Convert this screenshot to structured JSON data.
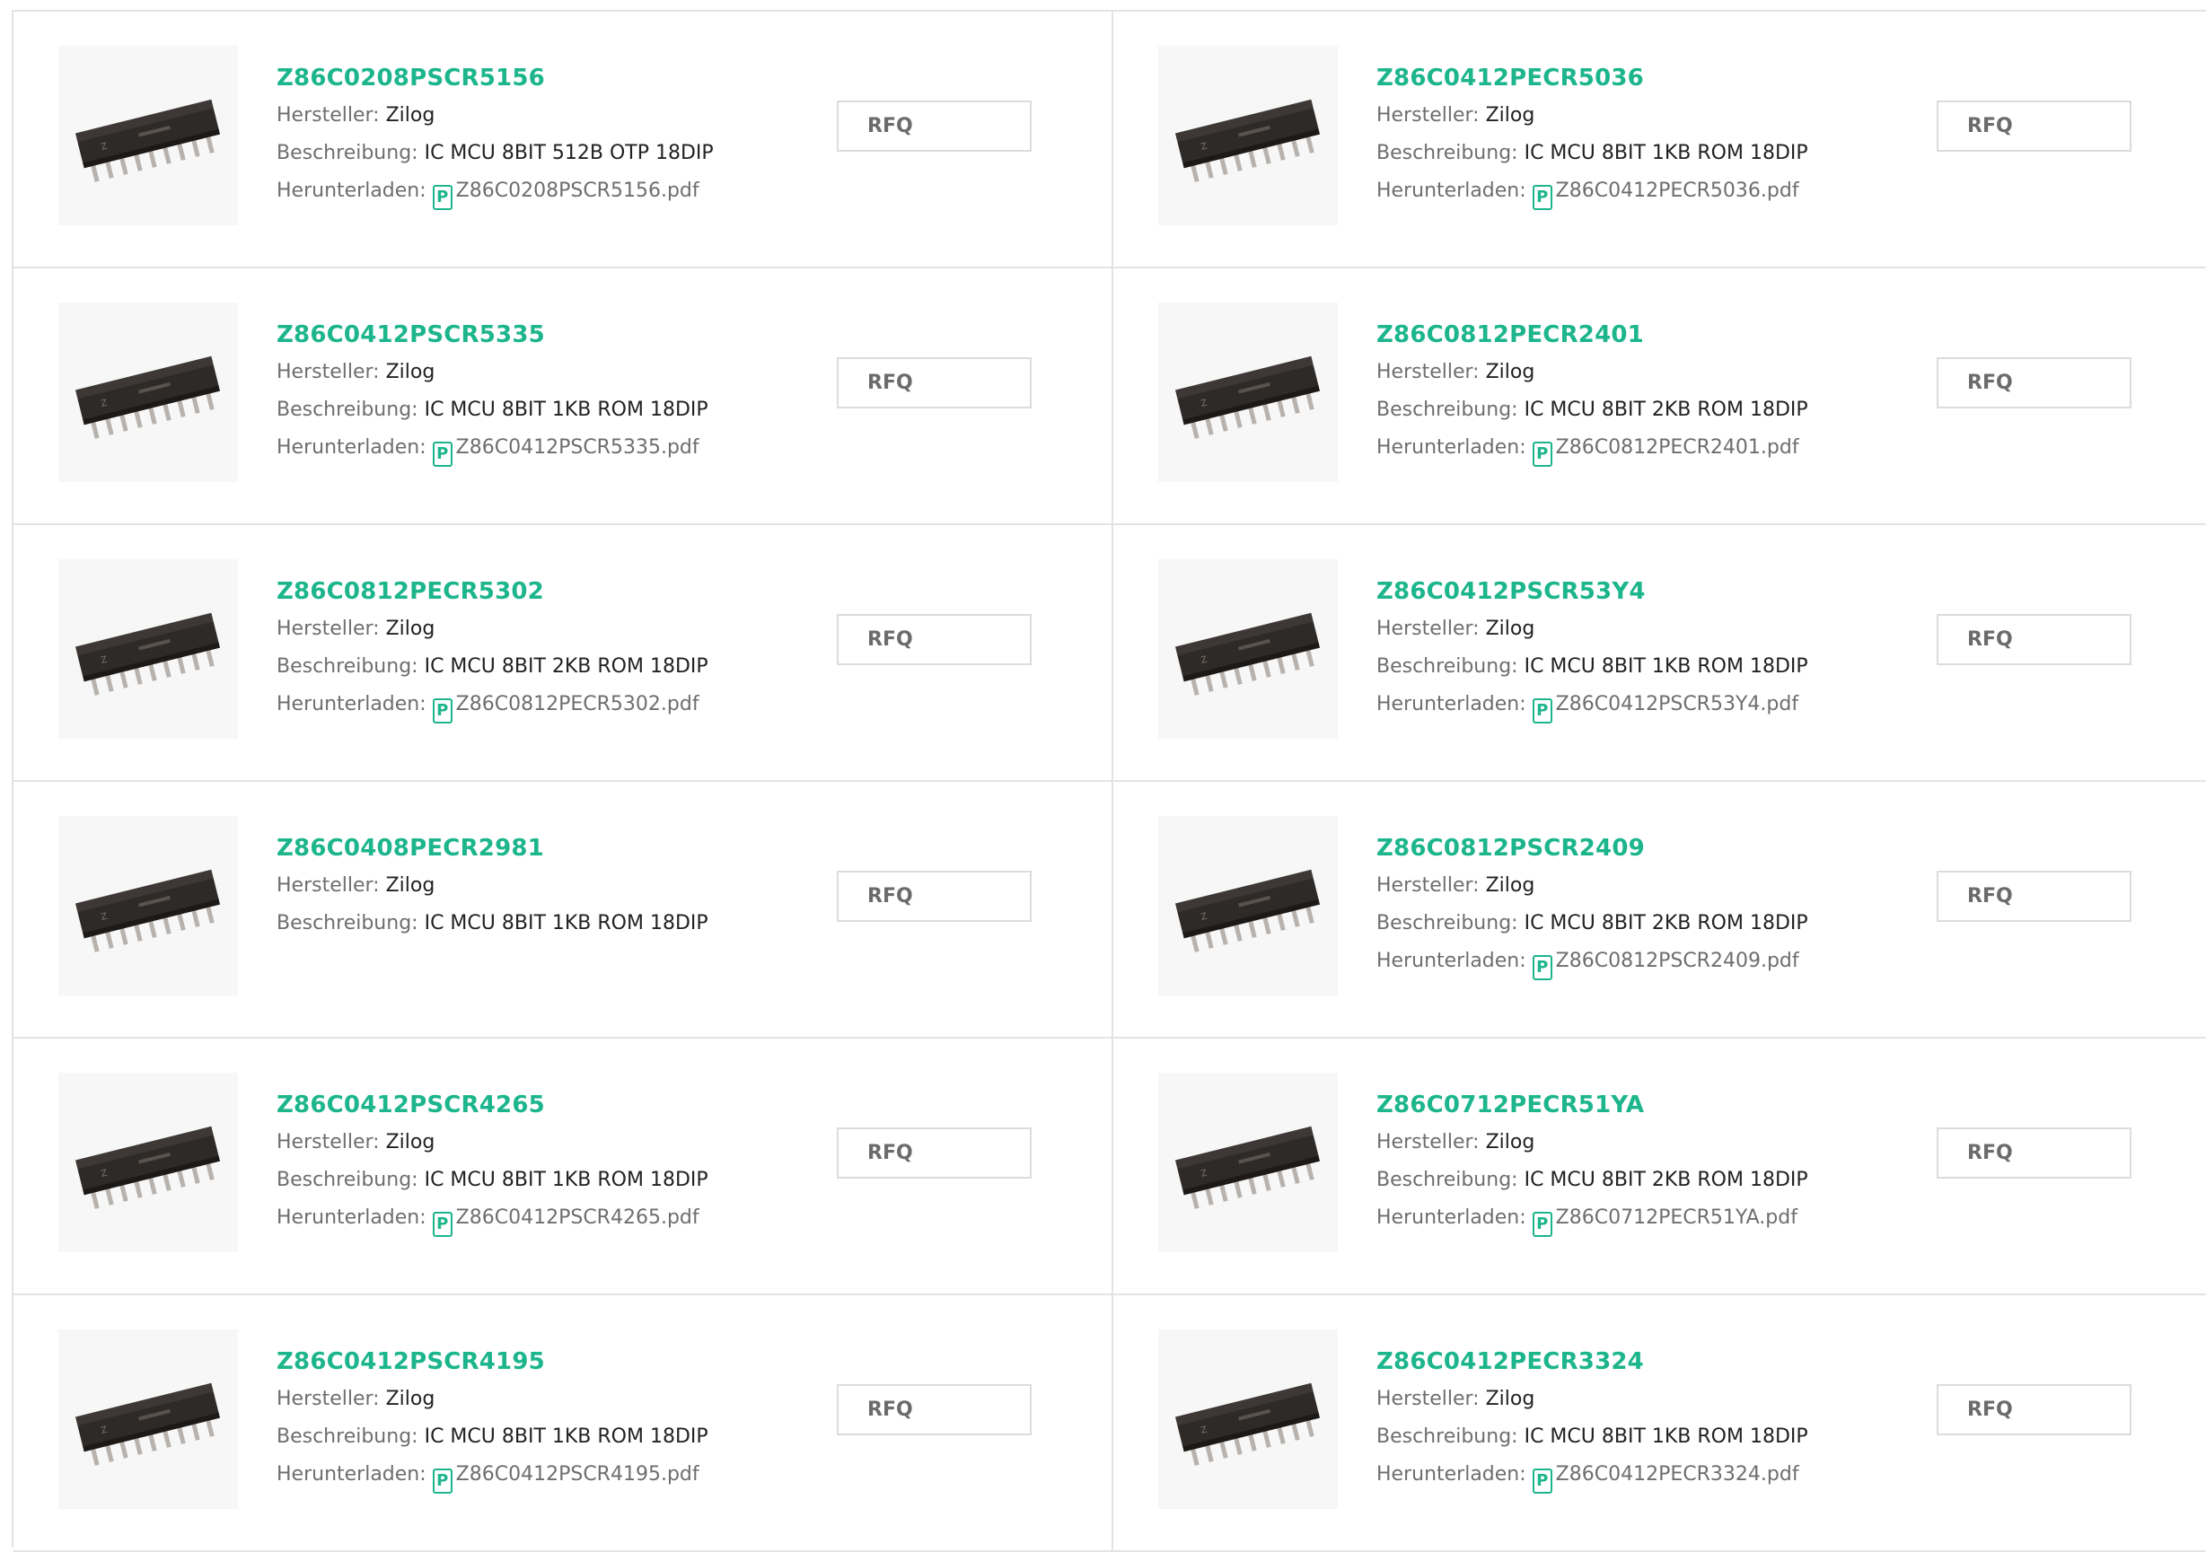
{
  "labels": {
    "manufacturer": "Hersteller:",
    "description": "Beschreibung:",
    "download": "Herunterladen:",
    "rfq": "RFQ"
  },
  "icons": {
    "product": "ic-chip-dip18-image",
    "pdf": "pdf-icon"
  },
  "products": [
    {
      "part": "Z86C0208PSCR5156",
      "manufacturer": "Zilog",
      "description": "IC MCU 8BIT 512B OTP 18DIP",
      "file": "Z86C0208PSCR5156.pdf"
    },
    {
      "part": "Z86C0412PECR5036",
      "manufacturer": "Zilog",
      "description": "IC MCU 8BIT 1KB ROM 18DIP",
      "file": "Z86C0412PECR5036.pdf"
    },
    {
      "part": "Z86C0412PSCR5335",
      "manufacturer": "Zilog",
      "description": "IC MCU 8BIT 1KB ROM 18DIP",
      "file": "Z86C0412PSCR5335.pdf"
    },
    {
      "part": "Z86C0812PECR2401",
      "manufacturer": "Zilog",
      "description": "IC MCU 8BIT 2KB ROM 18DIP",
      "file": "Z86C0812PECR2401.pdf"
    },
    {
      "part": "Z86C0812PECR5302",
      "manufacturer": "Zilog",
      "description": "IC MCU 8BIT 2KB ROM 18DIP",
      "file": "Z86C0812PECR5302.pdf"
    },
    {
      "part": "Z86C0412PSCR53Y4",
      "manufacturer": "Zilog",
      "description": "IC MCU 8BIT 1KB ROM 18DIP",
      "file": "Z86C0412PSCR53Y4.pdf"
    },
    {
      "part": "Z86C0408PECR2981",
      "manufacturer": "Zilog",
      "description": "IC MCU 8BIT 1KB ROM 18DIP",
      "file": null
    },
    {
      "part": "Z86C0812PSCR2409",
      "manufacturer": "Zilog",
      "description": "IC MCU 8BIT 2KB ROM 18DIP",
      "file": "Z86C0812PSCR2409.pdf"
    },
    {
      "part": "Z86C0412PSCR4265",
      "manufacturer": "Zilog",
      "description": "IC MCU 8BIT 1KB ROM 18DIP",
      "file": "Z86C0412PSCR4265.pdf"
    },
    {
      "part": "Z86C0712PECR51YA",
      "manufacturer": "Zilog",
      "description": "IC MCU 8BIT 2KB ROM 18DIP",
      "file": "Z86C0712PECR51YA.pdf"
    },
    {
      "part": "Z86C0412PSCR4195",
      "manufacturer": "Zilog",
      "description": "IC MCU 8BIT 1KB ROM 18DIP",
      "file": "Z86C0412PSCR4195.pdf"
    },
    {
      "part": "Z86C0412PECR3324",
      "manufacturer": "Zilog",
      "description": "IC MCU 8BIT 1KB ROM 18DIP",
      "file": "Z86C0412PECR3324.pdf"
    }
  ]
}
